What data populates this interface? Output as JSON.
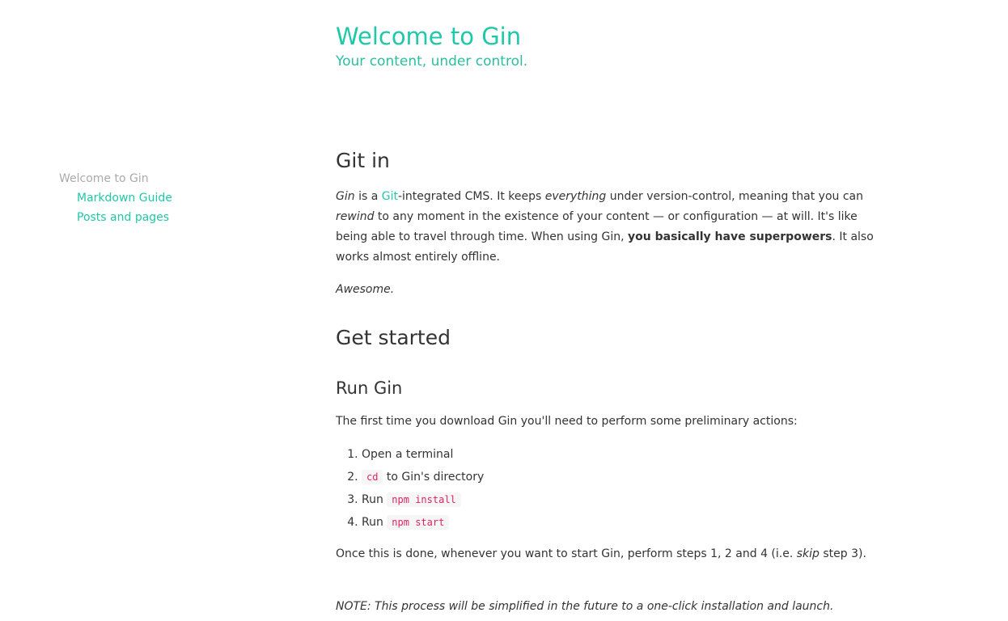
{
  "header": {
    "title": "Welcome to Gin",
    "tagline": "Your content, under control."
  },
  "sidebar": {
    "root": "Welcome to Gin",
    "items": [
      {
        "label": "Markdown Guide"
      },
      {
        "label": "Posts and pages"
      }
    ]
  },
  "content": {
    "h_gitin": "Git in",
    "intro": {
      "gin": "Gin",
      "is_a": " is a ",
      "git_link": "Git",
      "after_link": "-integrated CMS. It keeps ",
      "everything": "everything",
      "after_everything": " under version-control, meaning that you can ",
      "rewind": "rewind",
      "after_rewind": " to any moment in the existence of your content — or configuration — at will. It's like being able to travel through time. When using Gin, ",
      "superpowers": "you basically have superpowers",
      "tail": ". It also works almost entirely offline."
    },
    "awesome": "Awesome.",
    "h_getstarted": "Get started",
    "h_rungin": "Run Gin",
    "first_time": "The first time you download Gin you'll need to perform some preliminary actions:",
    "steps": [
      {
        "text": "Open a terminal"
      },
      {
        "code": "cd",
        "after": " to Gin's directory"
      },
      {
        "before": "Run ",
        "code": "npm install"
      },
      {
        "before": "Run ",
        "code": "npm start"
      }
    ],
    "once": {
      "before": "Once this is done, whenever you want to start Gin, perform steps 1, 2 and 4 (i.e. ",
      "skip": "skip",
      "after": " step 3)."
    },
    "note": "NOTE: This process will be simplified in the future to a one-click installation and launch."
  }
}
